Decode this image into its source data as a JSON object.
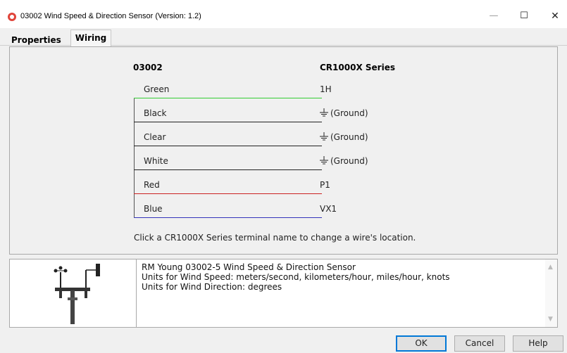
{
  "window": {
    "title": "03002 Wind Speed & Direction Sensor (Version: 1.2)",
    "minimize": "—",
    "maximize": "☐",
    "close": "✕"
  },
  "tabs": [
    {
      "label": "Properties",
      "active": false
    },
    {
      "label": "Wiring",
      "active": true
    }
  ],
  "wiring": {
    "sensor_header": "03002",
    "logger_header": "CR1000X Series",
    "wires": [
      {
        "name": "Green",
        "terminal": "1H",
        "color": "#33cc33",
        "ground": false
      },
      {
        "name": "Black",
        "terminal": "(Ground)",
        "color": "#222222",
        "ground": true
      },
      {
        "name": "Clear",
        "terminal": "(Ground)",
        "color": "#222222",
        "ground": true
      },
      {
        "name": "White",
        "terminal": "(Ground)",
        "color": "#222222",
        "ground": true
      },
      {
        "name": "Red",
        "terminal": "P1",
        "color": "#cc2222",
        "ground": false
      },
      {
        "name": "Blue",
        "terminal": "VX1",
        "color": "#3333bb",
        "ground": false
      }
    ],
    "hint": "Click a CR1000X Series terminal name to change a wire's location."
  },
  "info": {
    "lines": [
      "RM Young 03002-5 Wind Speed & Direction Sensor",
      "Units for Wind Speed: meters/second, kilometers/hour, miles/hour, knots",
      "Units for Wind Direction: degrees"
    ]
  },
  "buttons": {
    "ok": "OK",
    "cancel": "Cancel",
    "help": "Help"
  }
}
